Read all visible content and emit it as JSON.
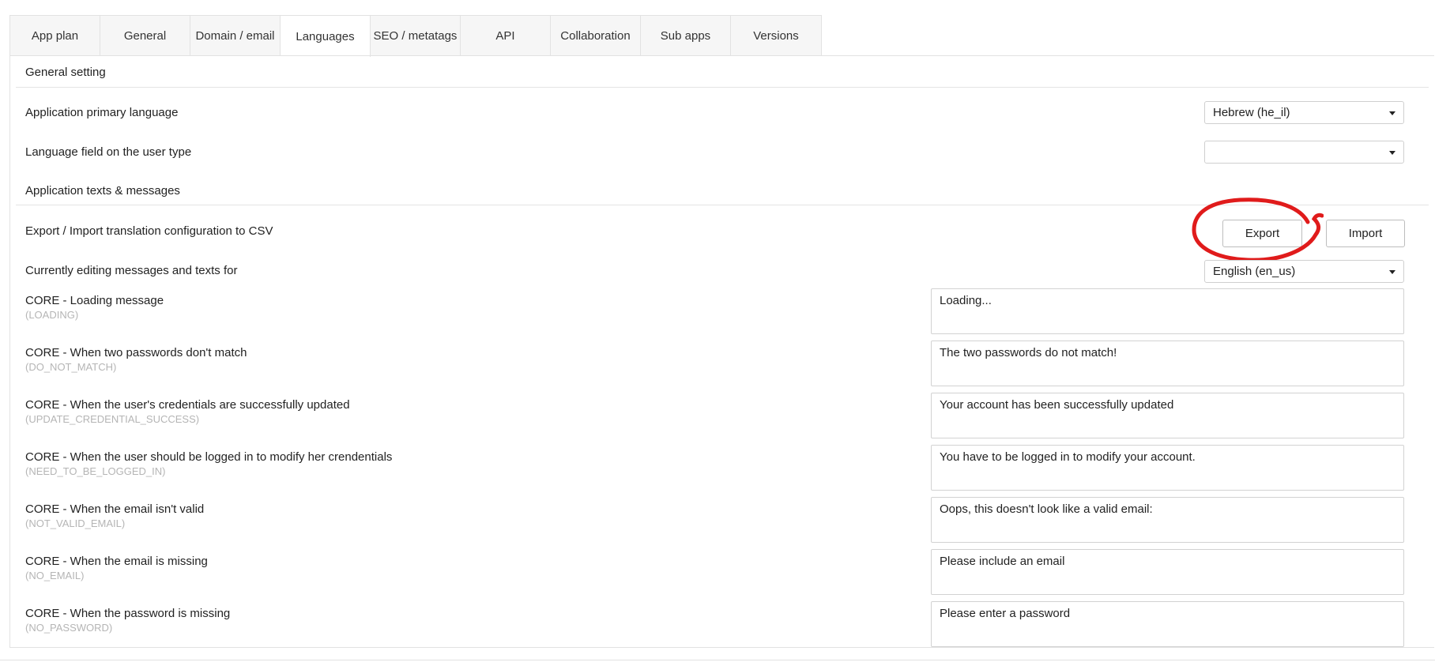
{
  "tabs": [
    "App plan",
    "General",
    "Domain / email",
    "Languages",
    "SEO / metatags",
    "API",
    "Collaboration",
    "Sub apps",
    "Versions"
  ],
  "active_tab": "Languages",
  "general_setting": {
    "title": "General setting",
    "primary_language_label": "Application primary language",
    "primary_language_value": "Hebrew (he_il)",
    "language_field_label": "Language field on the user type",
    "language_field_value": ""
  },
  "texts_section": {
    "title": "Application texts & messages",
    "export_import_label": "Export / Import translation configuration to CSV",
    "export_button": "Export",
    "import_button": "Import",
    "editing_label": "Currently editing messages and texts for",
    "editing_language": "English (en_us)"
  },
  "messages": [
    {
      "label": "CORE - Loading message",
      "key": "(LOADING)",
      "value": "Loading..."
    },
    {
      "label": "CORE - When two passwords don't match",
      "key": "(DO_NOT_MATCH)",
      "value": "The two passwords do not match!"
    },
    {
      "label": "CORE - When the user's credentials are successfully updated",
      "key": "(UPDATE_CREDENTIAL_SUCCESS)",
      "value": "Your account has been successfully updated"
    },
    {
      "label": "CORE - When the user should be logged in to modify her crendentials",
      "key": "(NEED_TO_BE_LOGGED_IN)",
      "value": "You have to be logged in to modify your account."
    },
    {
      "label": "CORE - When the email isn't valid",
      "key": "(NOT_VALID_EMAIL)",
      "value": "Oops, this doesn't look like a valid email:"
    },
    {
      "label": "CORE - When the email is missing",
      "key": "(NO_EMAIL)",
      "value": "Please include an email"
    },
    {
      "label": "CORE - When the password is missing",
      "key": "(NO_PASSWORD)",
      "value": "Please enter a password"
    }
  ],
  "colors": {
    "annotation": "#e01b1b",
    "border": "#e2e2e2",
    "muted_key": "#b5b5b5"
  }
}
